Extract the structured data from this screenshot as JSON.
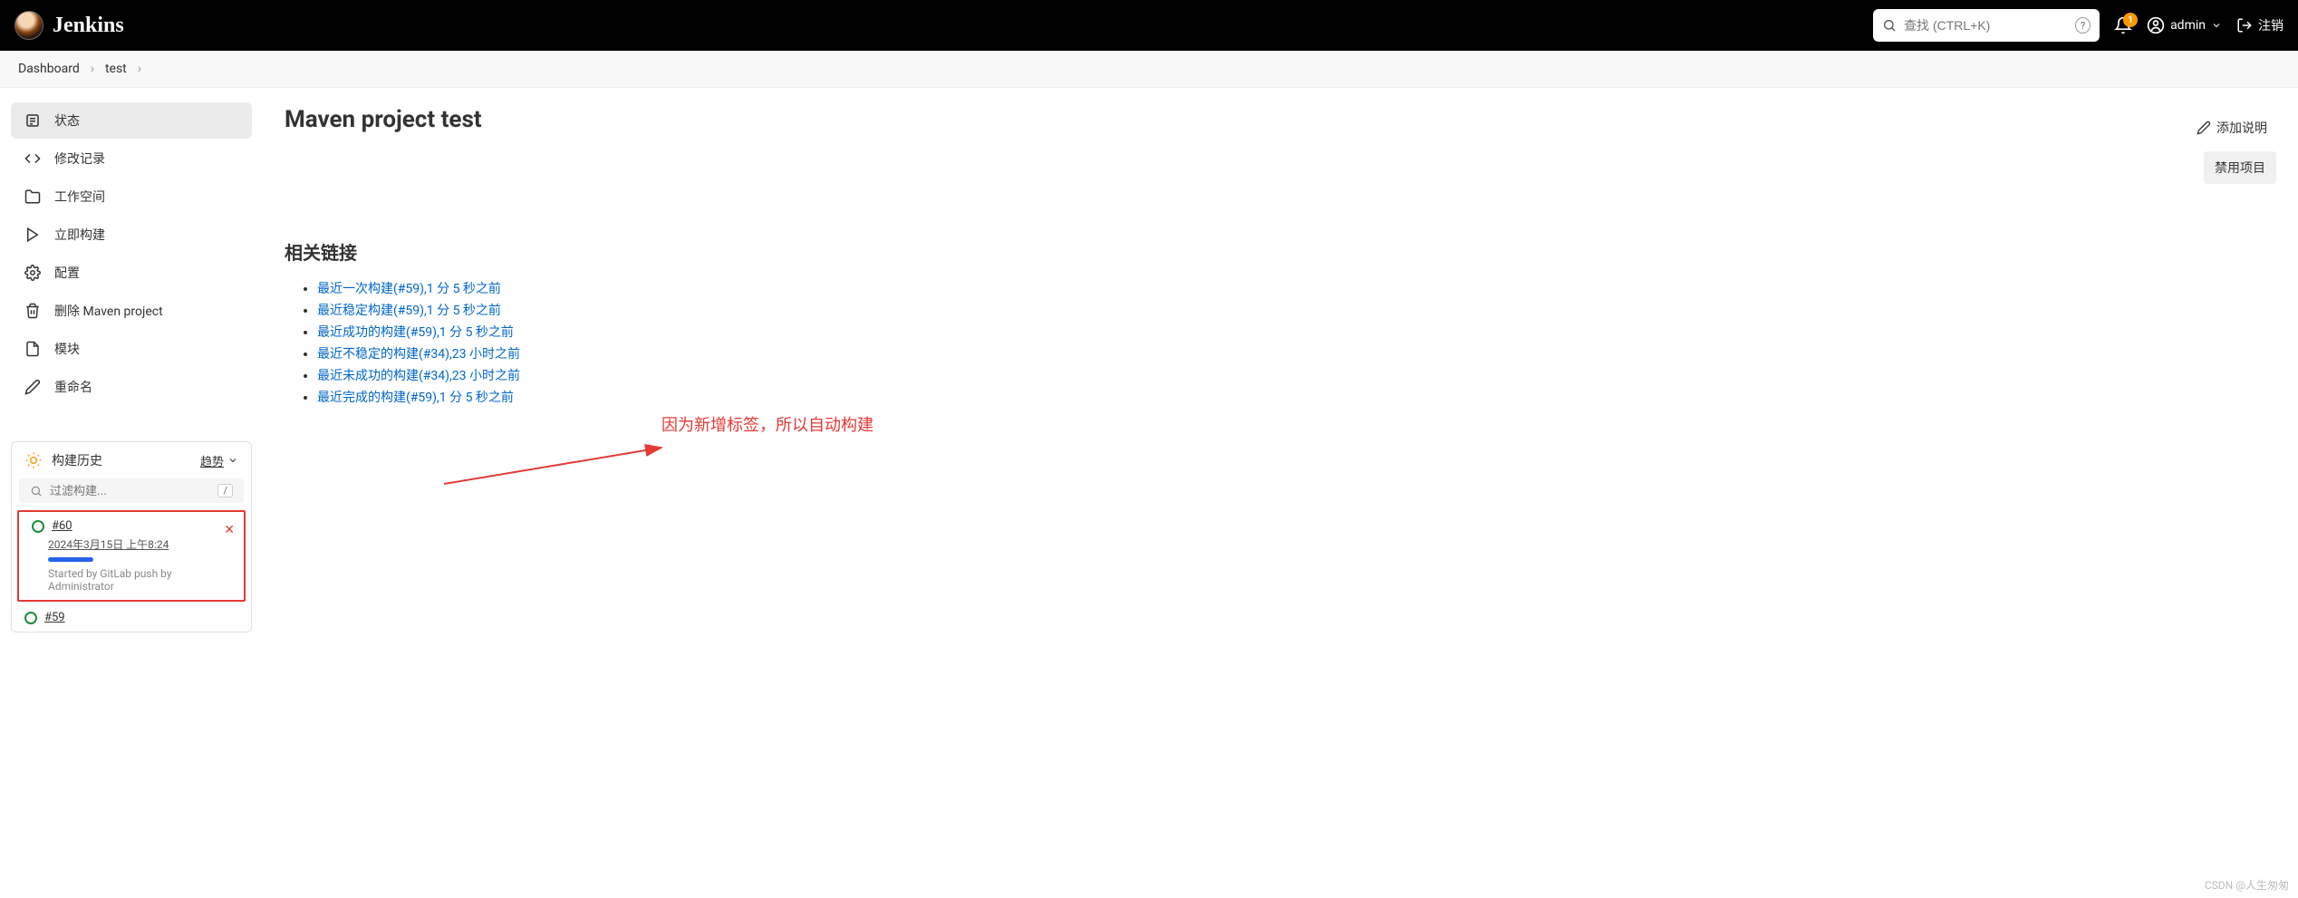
{
  "header": {
    "logo_text": "Jenkins",
    "search_placeholder": "查找 (CTRL+K)",
    "notification_count": "1",
    "username": "admin",
    "logout": "注销"
  },
  "breadcrumb": {
    "items": [
      "Dashboard",
      "test"
    ]
  },
  "sidebar": {
    "nav": [
      {
        "label": "状态",
        "icon": "status"
      },
      {
        "label": "修改记录",
        "icon": "changes"
      },
      {
        "label": "工作空间",
        "icon": "workspace"
      },
      {
        "label": "立即构建",
        "icon": "build"
      },
      {
        "label": "配置",
        "icon": "configure"
      },
      {
        "label": "删除 Maven project",
        "icon": "delete"
      },
      {
        "label": "模块",
        "icon": "modules"
      },
      {
        "label": "重命名",
        "icon": "rename"
      }
    ],
    "build_history": {
      "title": "构建历史",
      "trend": "趋势",
      "filter_placeholder": "过滤构建...",
      "builds": [
        {
          "number": "#60",
          "date": "2024年3月15日 上午8:24",
          "cause": "Started by GitLab push by Administrator",
          "running": true,
          "highlighted": true
        },
        {
          "number": "#59",
          "running": false
        }
      ]
    }
  },
  "main": {
    "title": "Maven project test",
    "add_description": "添加说明",
    "disable_project": "禁用项目",
    "related_links_title": "相关链接",
    "links": [
      "最近一次构建(#59),1 分 5 秒之前",
      "最近稳定构建(#59),1 分 5 秒之前",
      "最近成功的构建(#59),1 分 5 秒之前",
      "最近不稳定的构建(#34),23 小时之前",
      "最近未成功的构建(#34),23 小时之前",
      "最近完成的构建(#59),1 分 5 秒之前"
    ]
  },
  "annotation": {
    "text": "因为新增标签，所以自动构建"
  },
  "watermark": "CSDN @人生匆匆"
}
